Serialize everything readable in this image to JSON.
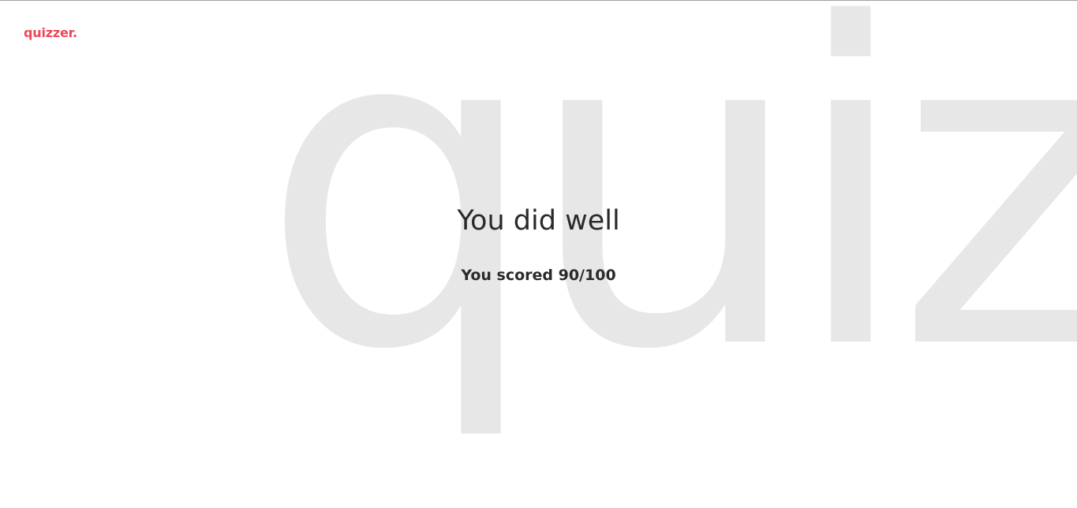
{
  "brand": {
    "logo_text": "quizzer.",
    "accent_color": "#f0465a"
  },
  "background": {
    "watermark_text": "quiz",
    "watermark_color": "#e7e7e7"
  },
  "result": {
    "title": "You did well",
    "score_text": "You scored 90/100"
  }
}
